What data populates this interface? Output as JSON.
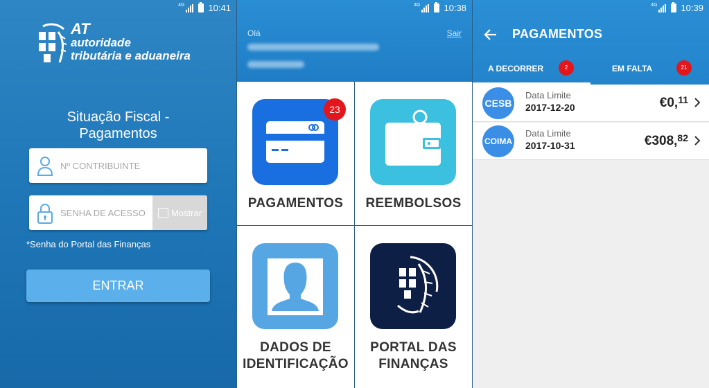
{
  "screen_login": {
    "status": {
      "network": "4G",
      "time": "10:41"
    },
    "logo": {
      "line1": "AT",
      "line2": "autoridade",
      "line3": "tributária e aduaneira"
    },
    "title_line1": "Situação Fiscal -",
    "title_line2": "Pagamentos",
    "taxpayer_placeholder": "Nº CONTRIBUINTE",
    "password_placeholder": "SENHA DE ACESSO",
    "show_label": "Mostrar",
    "note": "*Senha do Portal das Finanças",
    "enter_label": "ENTRAR"
  },
  "screen_menu": {
    "status": {
      "network": "4G",
      "time": "10:38"
    },
    "greeting": "Olá",
    "logout": "Sair",
    "tiles": [
      {
        "label_line1": "PAGAMENTOS",
        "label_line2": "",
        "badge": "23",
        "icon": "credit-card-icon",
        "color": "#1a6fe0"
      },
      {
        "label_line1": "REEMBOLSOS",
        "label_line2": "",
        "icon": "wallet-icon",
        "color": "#3cc0df"
      },
      {
        "label_line1": "DADOS  DE",
        "label_line2": "IDENTIFICAÇÃO",
        "icon": "person-icon",
        "color": "#56a6e3"
      },
      {
        "label_line1": "PORTAL DAS",
        "label_line2": "FINANÇAS",
        "icon": "portal-emblem-icon",
        "color": "#0e1f45"
      }
    ]
  },
  "screen_payments": {
    "status": {
      "network": "4G",
      "time": "10:39"
    },
    "title": "PAGAMENTOS",
    "tabs": [
      {
        "label": "A DECORRER",
        "badge": "2",
        "selected": true
      },
      {
        "label": "EM FALTA",
        "badge": "21",
        "selected": false
      }
    ],
    "items": [
      {
        "type": "CESB",
        "date_label": "Data Limite",
        "date": "2017-12-20",
        "amount_main": "€0,",
        "amount_cents": "11"
      },
      {
        "type": "COIMA",
        "date_label": "Data Limite",
        "date": "2017-10-31",
        "amount_main": "€308,",
        "amount_cents": "82"
      }
    ]
  }
}
